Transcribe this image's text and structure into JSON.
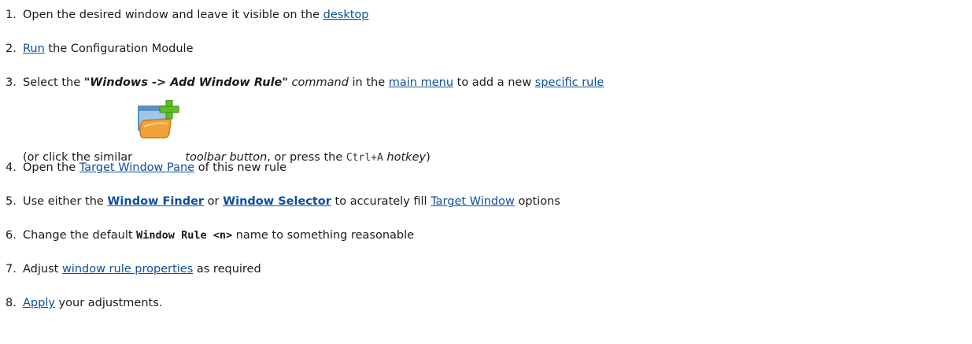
{
  "steps": [
    {
      "number": "1.",
      "text_a": "Open the desired window and leave it visible on the ",
      "link_desktop": "desktop"
    },
    {
      "number": "2.",
      "link_run": "Run",
      "text_a": " the Configuration Module"
    },
    {
      "number": "3.",
      "text_a": "Select the ",
      "command": "\"Windows -> Add Window Rule\"",
      "text_b": " command",
      "text_c": " in the ",
      "link_main_menu": "main menu",
      "text_d": " to add a new ",
      "link_specific_rule": "specific rule",
      "sub_a": "(or click the similar ",
      "sub_b": " toolbar button",
      "sub_c": ", or press the ",
      "hotkey_keys": "Ctrl+A",
      "sub_d": " hotkey",
      "sub_e": ")"
    },
    {
      "number": "4.",
      "text_a": "Open the ",
      "link_target_window_pane": "Target Window Pane",
      "text_b": " of this new rule"
    },
    {
      "number": "5.",
      "text_a": "Use either the ",
      "link_window_finder": "Window Finder",
      "text_b": " or ",
      "link_window_selector": "Window Selector",
      "text_c": " to accurately fill ",
      "link_target_window": "Target Window",
      "text_d": " options"
    },
    {
      "number": "6.",
      "text_a": "Change the default ",
      "default_name": "Window Rule <n>",
      "text_b": " name to something reasonable"
    },
    {
      "number": "7.",
      "text_a": "Adjust ",
      "link_window_rule_properties": "window rule properties",
      "text_b": " as required"
    },
    {
      "number": "8.",
      "link_apply": "Apply",
      "text_a": " your adjustments."
    }
  ],
  "icons": {
    "add_window_rule": "add-window-rule-icon"
  },
  "colors": {
    "link": "#0b4f9e",
    "text": "#1a1a1a",
    "icon_plus": "#5fbf1f",
    "icon_folder": "#f2a23a"
  }
}
